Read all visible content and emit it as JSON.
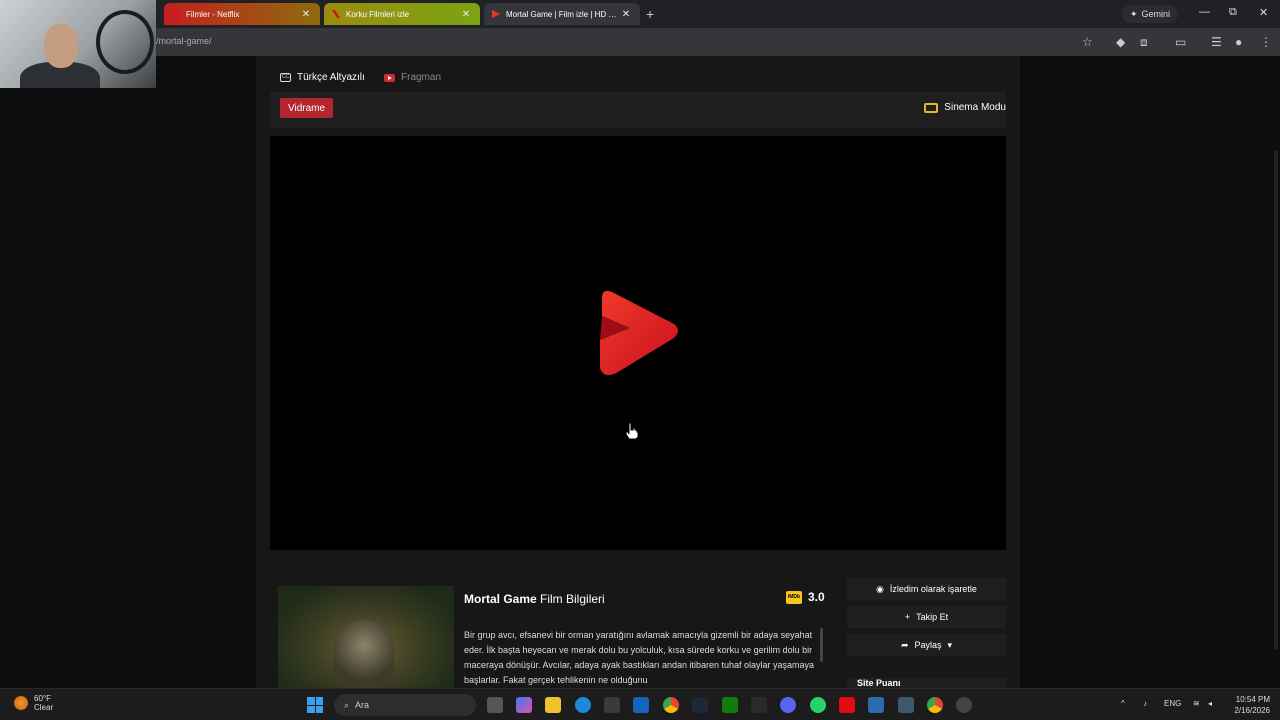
{
  "browser": {
    "tabs": [
      {
        "title": "Filmler - Netflix",
        "icon": "netflix-icon"
      },
      {
        "title": "Korku Filmleri izle",
        "icon": "site-icon"
      },
      {
        "title": "Mortal Game | Film izle | HD Film",
        "icon": "play-icon"
      }
    ],
    "new_tab": "+",
    "gemini_label": "Gemini",
    "url": "/mortal-game/",
    "window_controls": {
      "minimize": "—",
      "restore": "⧉",
      "close": "✕"
    }
  },
  "source_tabs": {
    "subtitle_label": "Türkçe Altyazılı",
    "trailer_label": "Fragman"
  },
  "server": {
    "button_label": "Vidrame",
    "cinema_label": "Sinema Modu"
  },
  "film": {
    "title_bold": "Mortal Game",
    "title_rest": " Film Bilgileri",
    "imdb_badge": "IMDb",
    "imdb_score": "3.0",
    "synopsis": "Bir grup avcı, efsanevi bir orman yaratığını avlamak amacıyla gizemli bir adaya seyahat eder. İlk başta heyecan ve merak dolu bu yolculuk, kısa sürede korku ve gerilim dolu bir maceraya dönüşür. Avcılar, adaya ayak bastıkları andan itibaren tuhaf olaylar yaşamaya başlarlar. Fakat gerçek tehlikenin ne olduğunu"
  },
  "actions": {
    "watched_label": "İzledim olarak işaretle",
    "follow_label": "Takip Et",
    "share_label": "Paylaş",
    "rating_heading": "Site Puanı"
  },
  "taskbar": {
    "weather_temp": "60°F",
    "weather_desc": "Clear",
    "search_label": "Ara",
    "language": "ENG",
    "time": "10:54 PM",
    "date": "2/16/2026"
  },
  "colors": {
    "accent_red": "#b3262e",
    "imdb_yellow": "#f5c518",
    "cinema_yellow": "#e6b422"
  }
}
